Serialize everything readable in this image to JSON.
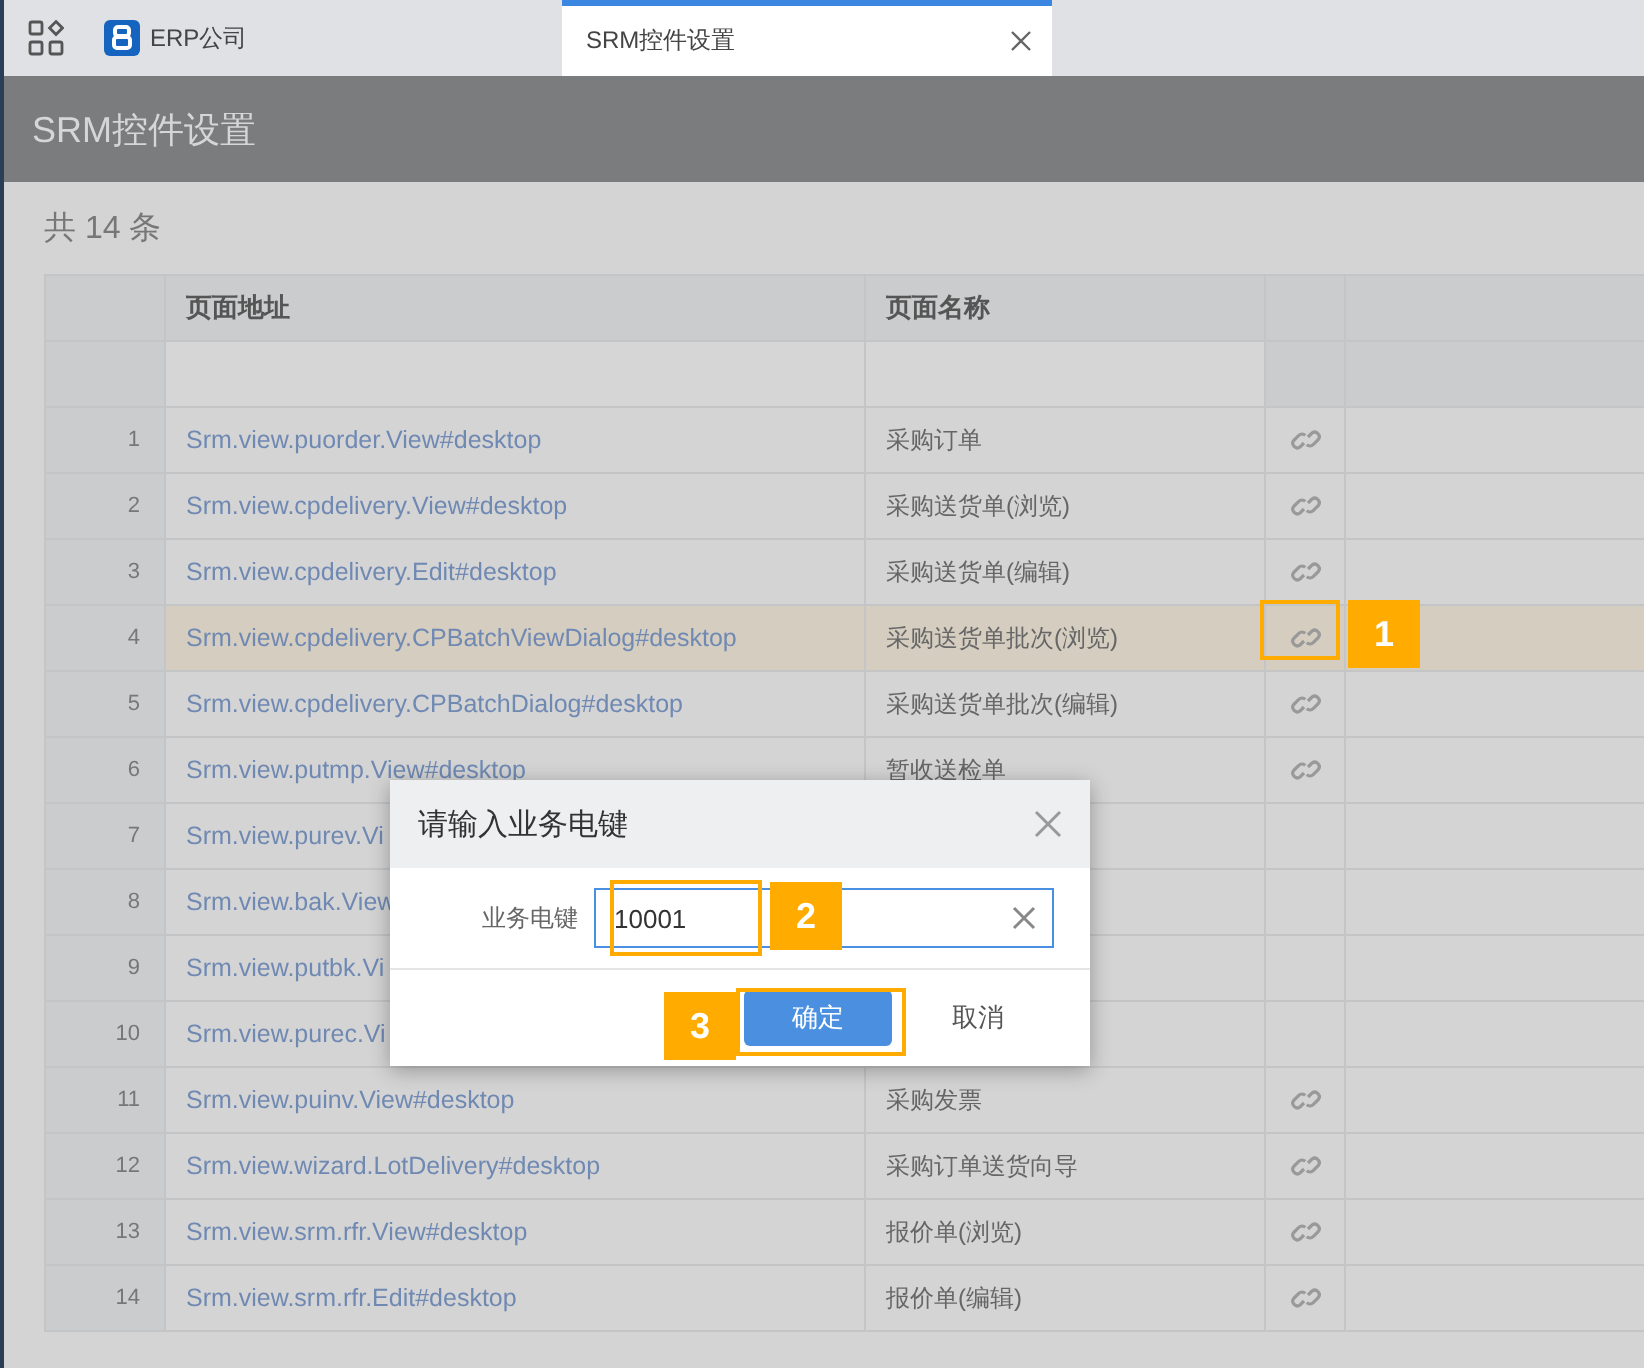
{
  "tabs": [
    {
      "label": "ERP公司",
      "selected": false,
      "kind": "home"
    },
    {
      "label": "SRM控件设置",
      "selected": true,
      "kind": "page"
    }
  ],
  "page_title": "SRM控件设置",
  "count": "共 14 条",
  "table": {
    "columns": [
      "页面地址",
      "页面名称"
    ],
    "rows": [
      {
        "index": "1",
        "address": "Srm.view.puorder.View#desktop",
        "name": "采购订单",
        "link": true,
        "selected": false
      },
      {
        "index": "2",
        "address": "Srm.view.cpdelivery.View#desktop",
        "name": "采购送货单(浏览)",
        "link": true,
        "selected": false
      },
      {
        "index": "3",
        "address": "Srm.view.cpdelivery.Edit#desktop",
        "name": "采购送货单(编辑)",
        "link": true,
        "selected": false
      },
      {
        "index": "4",
        "address": "Srm.view.cpdelivery.CPBatchViewDialog#desktop",
        "name": "采购送货单批次(浏览)",
        "link": true,
        "selected": true
      },
      {
        "index": "5",
        "address": "Srm.view.cpdelivery.CPBatchDialog#desktop",
        "name": "采购送货单批次(编辑)",
        "link": true,
        "selected": false
      },
      {
        "index": "6",
        "address": "Srm.view.putmp.View#desktop",
        "name": "暂收送检单",
        "link": true,
        "selected": false
      },
      {
        "index": "7",
        "address": "Srm.view.purev.Vi",
        "link": false,
        "selected": false
      },
      {
        "index": "8",
        "address": "Srm.view.bak.View",
        "link": false,
        "selected": false
      },
      {
        "index": "9",
        "address": "Srm.view.putbk.Vi",
        "link": false,
        "selected": false
      },
      {
        "index": "10",
        "address": "Srm.view.purec.Vi",
        "link": false,
        "selected": false
      },
      {
        "index": "11",
        "address": "Srm.view.puinv.View#desktop",
        "name": "采购发票",
        "link": true,
        "selected": false
      },
      {
        "index": "12",
        "address": "Srm.view.wizard.LotDelivery#desktop",
        "name": "采购订单送货向导",
        "link": true,
        "selected": false
      },
      {
        "index": "13",
        "address": "Srm.view.srm.rfr.View#desktop",
        "name": "报价单(浏览)",
        "link": true,
        "selected": false
      },
      {
        "index": "14",
        "address": "Srm.view.srm.rfr.Edit#desktop",
        "name": "报价单(编辑)",
        "link": true,
        "selected": false
      }
    ]
  },
  "dialog": {
    "title": "请输入业务电键",
    "field_label": "业务电键",
    "value": "10001",
    "buttons": [
      {
        "label": "确定",
        "kind": "primary"
      },
      {
        "label": "取消",
        "kind": "plain"
      }
    ]
  },
  "callouts": [
    "1",
    "2",
    "3"
  ]
}
